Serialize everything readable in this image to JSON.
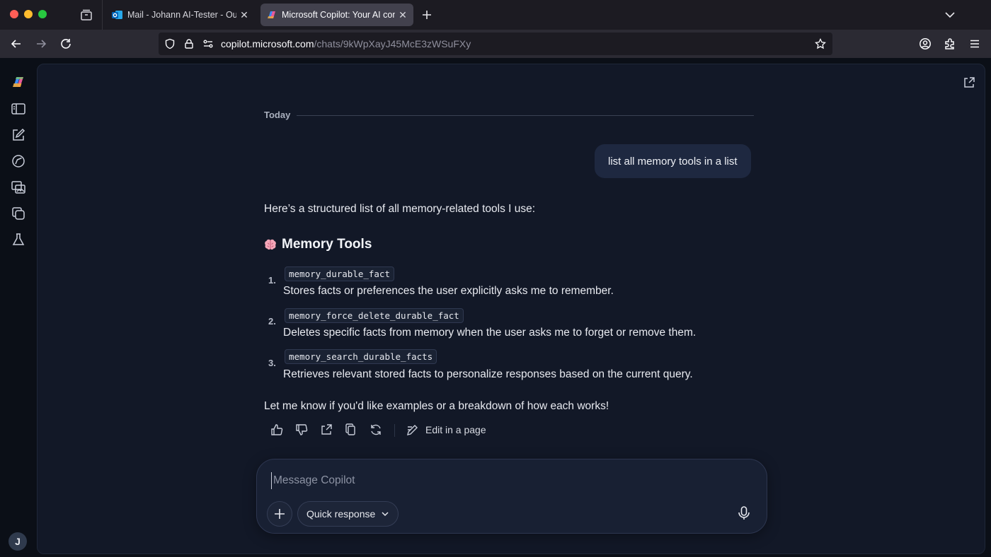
{
  "browser": {
    "tabs": [
      {
        "title": "Mail - Johann AI-Tester - Outlook",
        "favicon": "outlook-icon"
      },
      {
        "title": "Microsoft Copilot: Your AI companion",
        "favicon": "copilot-icon",
        "active": true
      }
    ],
    "url": {
      "host": "copilot.microsoft.com",
      "path": "/chats/9kWpXayJ45McE3zWSuFXy"
    }
  },
  "sidebar": {
    "icons": [
      "copilot-logo-icon",
      "sidebar-toggle-icon",
      "new-chat-icon",
      "discover-icon",
      "imagine-icon",
      "pages-icon",
      "labs-icon"
    ],
    "avatar_initial": "J"
  },
  "chat": {
    "day_label": "Today",
    "user_message": "list all memory tools in a list",
    "response": {
      "intro": "Here’s a structured list of all memory-related tools I use:",
      "heading": "Memory Tools",
      "items": [
        {
          "number": "1.",
          "code": "memory_durable_fact",
          "description": "Stores facts or preferences the user explicitly asks me to remember."
        },
        {
          "number": "2.",
          "code": "memory_force_delete_durable_fact",
          "description": "Deletes specific facts from memory when the user asks me to forget or remove them."
        },
        {
          "number": "3.",
          "code": "memory_search_durable_facts",
          "description": "Retrieves relevant stored facts to personalize responses based on the current query."
        }
      ],
      "outro": "Let me know if you'd like examples or a breakdown of how each works!"
    },
    "actions": {
      "edit_in_page_label": "Edit in a page"
    }
  },
  "composer": {
    "placeholder": "Message Copilot",
    "mode_label": "Quick response"
  },
  "colors": {
    "background": "#0b0f17",
    "panel": "#121827",
    "user_bubble": "#1e2840",
    "composer": "#182033"
  }
}
